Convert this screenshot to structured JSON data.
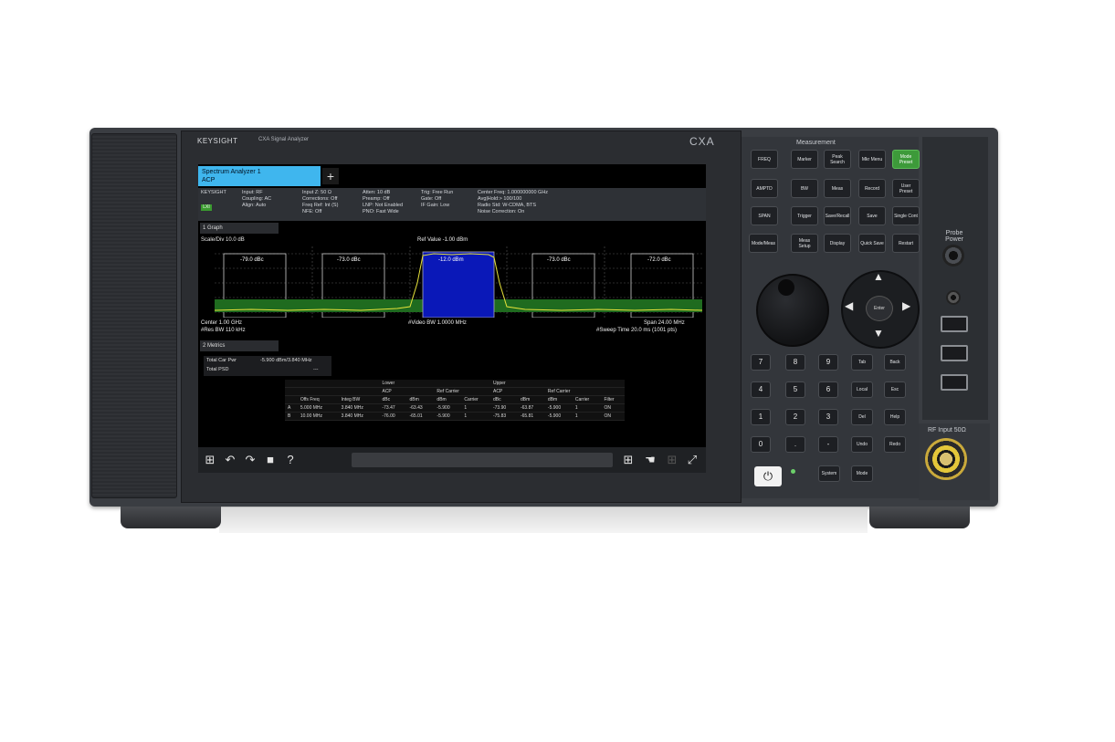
{
  "brand": "KEYSIGHT",
  "model_text": "CXA Signal Analyzer",
  "series": "CXA",
  "screen": {
    "tab_title": "Spectrum Analyzer 1",
    "tab_subtitle": "ACP",
    "add_tab": "+",
    "lxi_badge": "LXI",
    "info_columns": [
      {
        "l1": "KEYSIGHT",
        "l2": "",
        "l3": ""
      },
      {
        "l1": "Input: RF",
        "l2": "Coupling: AC",
        "l3": "Align: Auto"
      },
      {
        "l1": "Input Z: 50 Ω",
        "l2": "Corrections: Off",
        "l3": "Freq Ref: Int (S)",
        "l4": "NFE: Off"
      },
      {
        "l1": "Atten: 10 dB",
        "l2": "Preamp: Off",
        "l3": "LNP: Not Enabled",
        "l4": "PNO: Fast Wide"
      },
      {
        "l1": "Trig: Free Run",
        "l2": "Gate: Off",
        "l3": "IF Gain: Low"
      },
      {
        "l1": "Center Freq: 1.000000000 GHz",
        "l2": "Avg|Hold:> 100/100",
        "l3": "Radio Std: W-CDMA, BTS",
        "l4": "Noise Correction: On"
      }
    ],
    "graph_selector": "1 Graph",
    "scale_label": "Scale/Div 10.0 dB",
    "channel_label": "Ref Value -1.00 dBm",
    "center_label": "Center 1.00 GHz",
    "res_bw_label": "#Res BW 110 kHz",
    "video_bw_label": "#Video BW 1.0000 MHz",
    "span_label": "Span 24.00 MHz",
    "sweep_label": "#Sweep Time 20.0 ms (1001 pts)",
    "channel_values": [
      "-79.0 dBc",
      "-73.0 dBc",
      "-12.0 dBm",
      "-73.0 dBc",
      "-72.0 dBc"
    ],
    "metrics_selector": "2 Metrics",
    "total_carrier_power_label": "Total Car Pwr",
    "total_carrier_power_value": "-5.900 dBm/3.840 MHz",
    "total_psd_label": "Total PSD",
    "total_psd_value": "---",
    "acp_table": {
      "group_headers": [
        "Lower",
        "Upper"
      ],
      "sub_headers": [
        "ACP",
        "Ref Carrier",
        "ACP",
        "Ref Carrier"
      ],
      "columns": [
        "Offs Freq",
        "Integ BW",
        "dBc",
        "dBm",
        "dBm",
        "Carrier",
        "dBc",
        "dBm",
        "dBm",
        "Carrier",
        "Filter"
      ],
      "rows": [
        [
          "A",
          "5.000 MHz",
          "3.840 MHz",
          "-73.47",
          "-63.43",
          "-5.900",
          "1",
          "-73.90",
          "-63.87",
          "-5.900",
          "1",
          "ON"
        ],
        [
          "B",
          "10.00 MHz",
          "3.840 MHz",
          "-76.00",
          "-65.01",
          "-5.900",
          "1",
          "-75.83",
          "-65.81",
          "-5.900",
          "1",
          "ON"
        ]
      ]
    },
    "taskbar_search_placeholder": ""
  },
  "panel": {
    "section_label": "Measurement",
    "keys": [
      [
        "FREQ",
        "Marker",
        "Peak Search",
        "Mkr Menu",
        "Mode Preset"
      ],
      [
        "AMPTD",
        "BW",
        "Meas",
        "Record",
        "User Preset"
      ],
      [
        "SPAN",
        "Trigger",
        "Save/Recall",
        "Save",
        "Single Cont"
      ],
      [
        "Mode/Meas",
        "Meas Setup",
        "Display",
        "Quick Save",
        "Restart"
      ]
    ],
    "enter_label": "Enter",
    "num_keys": [
      "7",
      "8",
      "9",
      "4",
      "5",
      "6",
      "1",
      "2",
      "3",
      "0",
      ".",
      "-"
    ],
    "side_keys": [
      "Tab",
      "Back",
      "Local",
      "Esc",
      "Del",
      "Help",
      "Undo",
      "Redo",
      "System",
      "Mode"
    ]
  },
  "ports": {
    "probe_label": "Probe Power",
    "rf_label": "RF Input 50Ω"
  },
  "colors": {
    "tab_blue": "#3fb6ee",
    "carrier_blue": "#0a18b8",
    "noise_green": "#1f6b1f",
    "trace_yellow": "#e6e23a",
    "mode_preset_green": "#3d9a3a"
  }
}
